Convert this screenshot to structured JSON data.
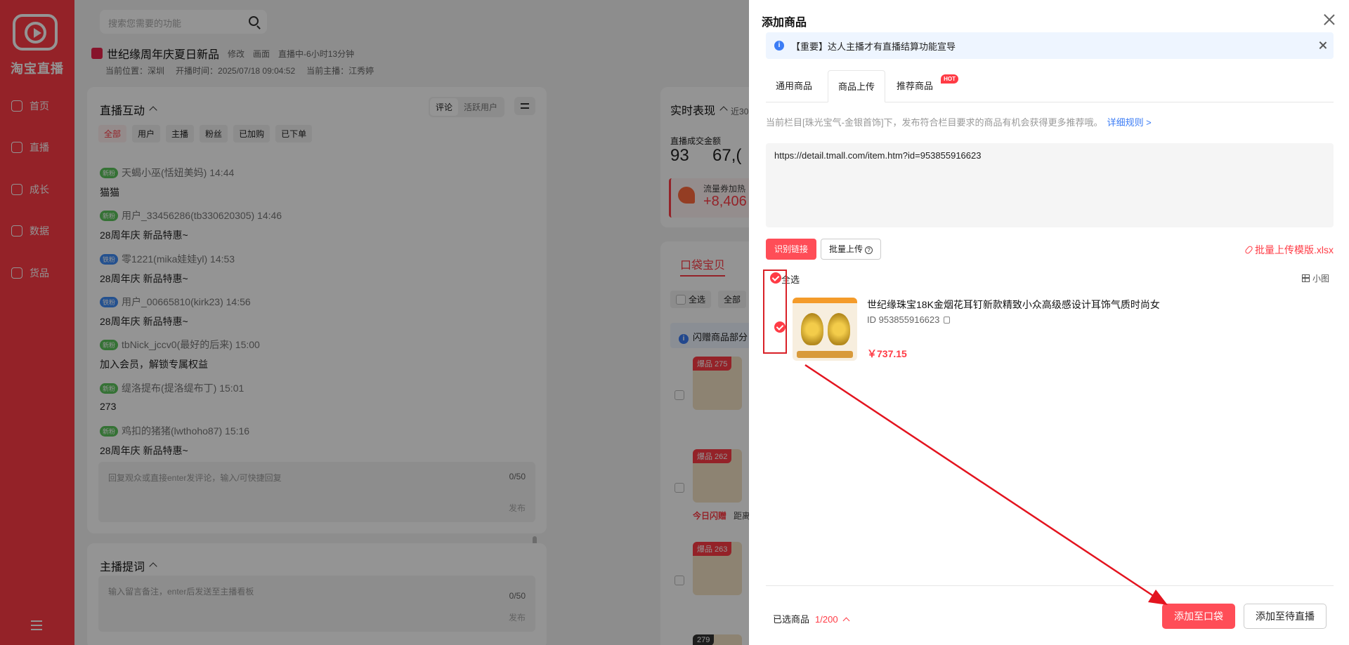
{
  "sidebar": {
    "logo_text": "淘宝直播",
    "items": [
      {
        "label": "首页",
        "icon": "home-icon"
      },
      {
        "label": "直播",
        "icon": "live-icon"
      },
      {
        "label": "成长",
        "icon": "growth-icon"
      },
      {
        "label": "数据",
        "icon": "data-icon"
      },
      {
        "label": "货品",
        "icon": "goods-icon"
      }
    ]
  },
  "search": {
    "placeholder": "搜索您需要的功能"
  },
  "live": {
    "title": "世纪缘周年庆夏日新品",
    "edit": "修改",
    "view": "画面",
    "status": "直播中-6小时13分钟",
    "location": "当前位置：深圳",
    "start_time": "开播时间：2025/07/18 09:04:52",
    "anchor": "当前主播：江秀婷"
  },
  "interaction": {
    "title": "直播互动",
    "seg": [
      "评论",
      "活跃用户"
    ],
    "chips": [
      "全部",
      "用户",
      "主播",
      "粉丝",
      "已加购",
      "已下单"
    ],
    "messages": [
      {
        "tag": "新粉",
        "tag_type": "new",
        "user": "天蝎小巫(恬妞美妈) 14:44",
        "text": "猫猫"
      },
      {
        "tag": "新粉",
        "tag_type": "new",
        "user": "用户_33456286(tb330620305) 14:46",
        "text": "28周年庆 新品特惠~"
      },
      {
        "tag": "铁粉",
        "tag_type": "old",
        "user": "零1221(mika娃娃yl) 14:53",
        "text": "28周年庆 新品特惠~"
      },
      {
        "tag": "铁粉",
        "tag_type": "old",
        "user": "用户_00665810(kirk23) 14:56",
        "text": "28周年庆 新品特惠~"
      },
      {
        "tag": "新粉",
        "tag_type": "new",
        "user": "tbNick_jccv0(最好的后来) 15:00",
        "text": "加入会员，解锁专属权益"
      },
      {
        "tag": "新粉",
        "tag_type": "new",
        "user": "缇洛提布(提洛缇布丁) 15:01",
        "text": "273"
      },
      {
        "tag": "新粉",
        "tag_type": "new",
        "user": "鸡扣的猪猪(lwthoho87) 15:16",
        "text": "28周年庆 新品特惠~"
      }
    ],
    "reply_placeholder": "回复观众或直接enter发评论，输入/可快捷回复",
    "reply_count": "0/50",
    "send": "发布"
  },
  "prompter": {
    "title": "主播提词",
    "placeholder": "输入留言备注，enter后发送至主播看板",
    "count": "0/50",
    "send": "发布"
  },
  "realtime": {
    "title": "实时表现",
    "range": "近30",
    "gmv_label": "直播成交金额",
    "gmv_a": "93",
    "gmv_b": "67,(",
    "coupon_label": "流量券加热",
    "coupon_value": "+8,406"
  },
  "bag": {
    "tab": "口袋宝贝",
    "select_all": "全选",
    "select_all2": "全部",
    "notice": "闪赠商品部分",
    "cards": [
      {
        "tag": "爆品 275"
      },
      {
        "tag": "爆品 262",
        "flash": "今日闪赠",
        "extra": "距离"
      },
      {
        "tag": "爆品 263"
      },
      {
        "tag": "279"
      }
    ]
  },
  "panel": {
    "title": "添加商品",
    "notice": "【重要】达人主播才有直播结算功能宣导",
    "tabs": [
      "通用商品",
      "商品上传",
      "推荐商品"
    ],
    "hot_badge": "HOT",
    "rule_text": "当前栏目[珠光宝气-金银首饰]下，发布符合栏目要求的商品有机会获得更多推荐哦。",
    "rule_link": "详细规则 >",
    "url_value": "https://detail.tmall.com/item.htm?id=953855916623",
    "identify_btn": "识别链接",
    "batch_btn": "批量上传",
    "template_link": "批量上传模版.xlsx",
    "select_all": "全选",
    "view_toggle": "小图",
    "product": {
      "name": "世纪缘珠宝18K金烟花耳钉新款精致小众高级感设计耳饰气质时尚女",
      "id": "ID 953855916623",
      "price": "￥737.15"
    },
    "selected_label": "已选商品",
    "selected_count": "1/200",
    "add_bag_btn": "添加至口袋",
    "add_pending_btn": "添加至待直播"
  },
  "colors": {
    "accent": "#ff3b45",
    "link": "#3b7cf5",
    "annotation": "#d92027"
  }
}
